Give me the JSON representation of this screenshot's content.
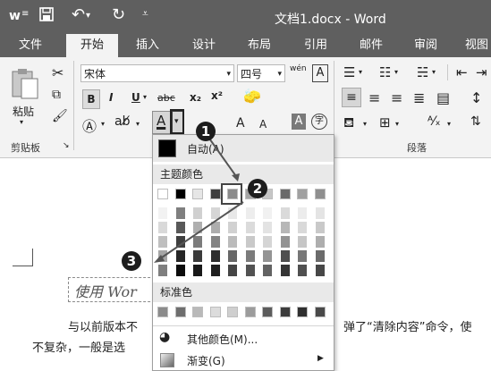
{
  "titlebar": {
    "word_icon": "w",
    "title": "文档1.docx - Word"
  },
  "tabs": [
    "文件",
    "开始",
    "插入",
    "设计",
    "布局",
    "引用",
    "邮件",
    "审阅",
    "视图"
  ],
  "active_tab": "开始",
  "clipboard": {
    "paste_label": "粘贴",
    "group_label": "剪贴板"
  },
  "font": {
    "font_name": "宋体",
    "font_size": "四号",
    "wen_glyph": "wén",
    "a_box": "A",
    "bold": "B",
    "italic": "I",
    "underline": "U",
    "strike": "abc",
    "subscript": "x₂",
    "superscript": "x²",
    "grow": "A",
    "shrink": "A",
    "circled": "字",
    "highlight_a": "A"
  },
  "paragraph": {
    "group_label": "段落"
  },
  "color_panel": {
    "auto_label": "自动(A)",
    "theme_header": "主题颜色",
    "standard_header": "标准色",
    "more_colors": "其他颜色(M)...",
    "gradient": "渐变(G)"
  },
  "document": {
    "sample_text": "使用 Wor",
    "line1_left": "与以前版本不",
    "line1_right": "弹了“清除内容”命令，使",
    "line2_left": "不复杂，一般是选"
  },
  "callouts": [
    "1",
    "2",
    "3"
  ],
  "colors": {
    "titlebar_bg": "#5f5f5f",
    "ribbon_bg": "#f3f3f3",
    "header_bg": "#e9e9e9"
  },
  "theme_colors": {
    "top_row": [
      "#ffffff",
      "#000000",
      "#e6e6e6",
      "#3f3f3f",
      "#8a8a8a",
      "#a5a5a5",
      "#c6c6c6",
      "#6a6a6a",
      "#a0a0a0",
      "#8f8f8f"
    ],
    "shades": [
      [
        "#f2f2f2",
        "#7f7f7f",
        "#d0d0d0",
        "#d6d6d6",
        "#e8e8e8",
        "#ededed",
        "#f1f1f1",
        "#dadada",
        "#ececec",
        "#e4e4e4"
      ],
      [
        "#d9d9d9",
        "#595959",
        "#afafaf",
        "#adadad",
        "#d1d1d1",
        "#dbdbdb",
        "#e3e3e3",
        "#b7b7b7",
        "#d9d9d9",
        "#c9c9c9"
      ],
      [
        "#bfbfbf",
        "#3f3f3f",
        "#7c7c7c",
        "#848484",
        "#bbbbbb",
        "#c9c9c9",
        "#d5d5d5",
        "#939393",
        "#c6c6c6",
        "#aeaeae"
      ],
      [
        "#a5a5a5",
        "#262626",
        "#3b3b3b",
        "#2e2e2e",
        "#676767",
        "#7b7b7b",
        "#949494",
        "#4f4f4f",
        "#777777",
        "#6b6b6b"
      ],
      [
        "#7f7f7f",
        "#0c0c0c",
        "#191919",
        "#1f1f1f",
        "#454545",
        "#525252",
        "#636363",
        "#353535",
        "#505050",
        "#474747"
      ]
    ],
    "standard": [
      "#8b8b8b",
      "#6e6e6e",
      "#b9b9b9",
      "#dcdcdc",
      "#cfcfcf",
      "#9c9c9c",
      "#5c5c5c",
      "#3c3c3c",
      "#2f2f2f",
      "#494949"
    ]
  }
}
